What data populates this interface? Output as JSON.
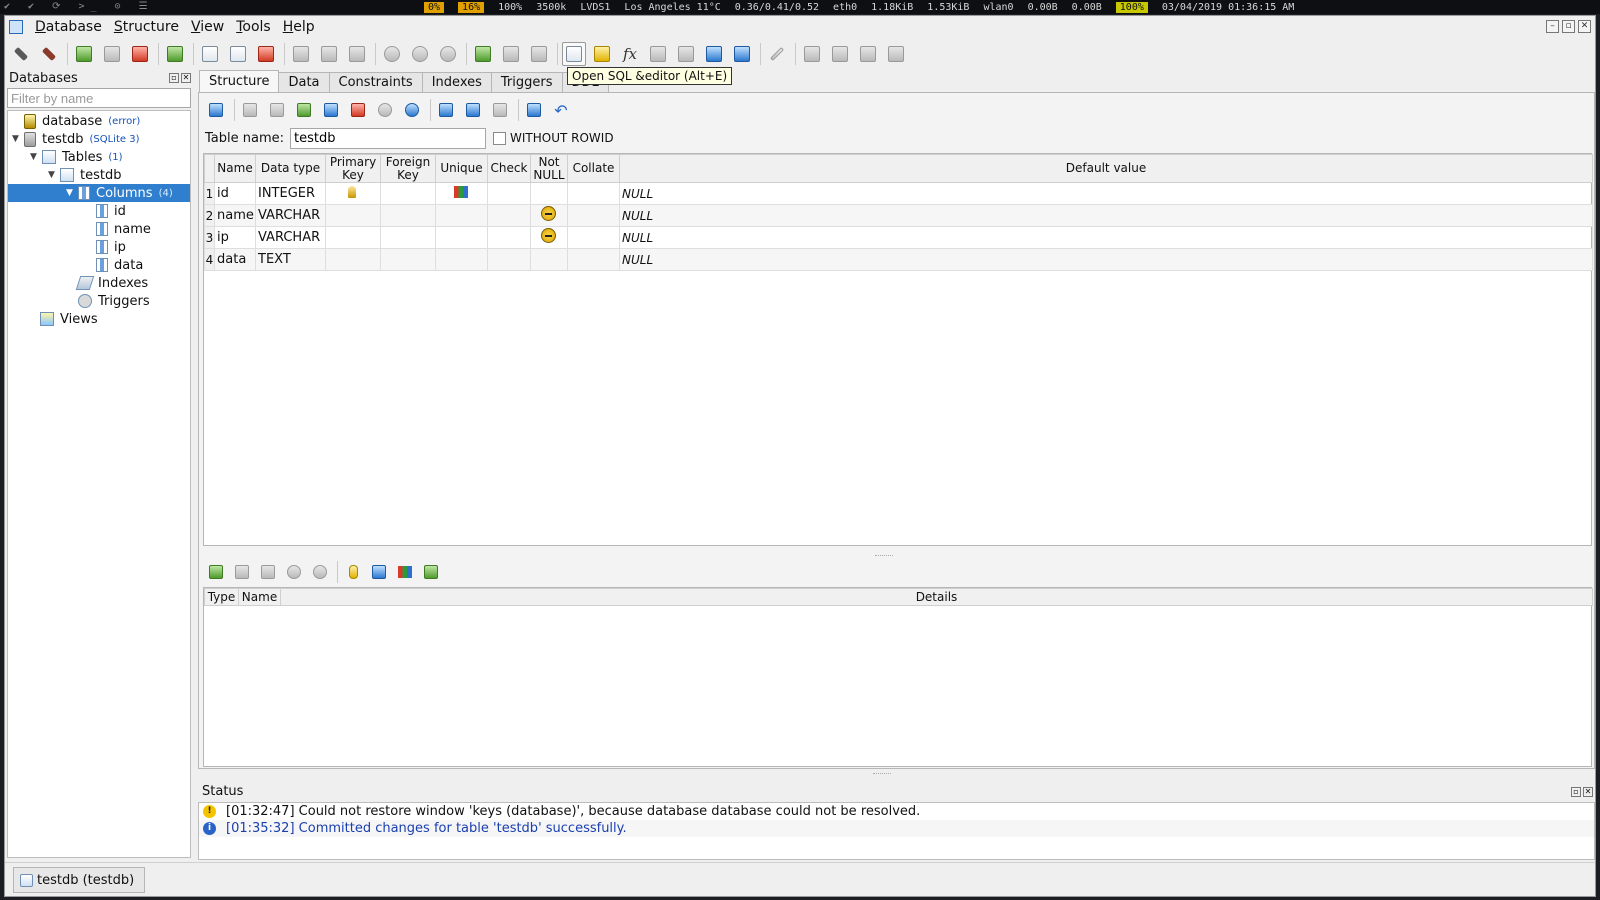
{
  "system_bar": {
    "workspace_icons": "✔ ✔ ⟳ >_ ⊙ ☰",
    "cpu": "0%",
    "cpu2": "16%",
    "volume": "100%",
    "freq": "3500k",
    "display": "LVDS1",
    "weather": "Los Angeles 11°C",
    "load": "0.36/0.41/0.52",
    "eth_label": "eth0",
    "eth_down": "1.18KiB",
    "eth_up": "1.53KiB",
    "wlan_label": "wlan0",
    "wlan_down": "0.00B",
    "wlan_up": "0.00B",
    "battery": "100%",
    "datetime": "03/04/2019 01:36:15 AM"
  },
  "menubar": {
    "items": [
      "Database",
      "Structure",
      "View",
      "Tools",
      "Help"
    ]
  },
  "tooltip": "Open SQL &editor (Alt+E)",
  "left_panel": {
    "title": "Databases",
    "filter_placeholder": "Filter by name",
    "tree": {
      "database": {
        "label": "database",
        "tag": "(error)"
      },
      "testdb": {
        "label": "testdb",
        "tag": "(SQLite 3)"
      },
      "tables": {
        "label": "Tables",
        "tag": "(1)"
      },
      "table_testdb": {
        "label": "testdb"
      },
      "columns": {
        "label": "Columns",
        "tag": "(4)"
      },
      "col_items": [
        "id",
        "name",
        "ip",
        "data"
      ],
      "indexes": "Indexes",
      "triggers": "Triggers",
      "views": "Views"
    }
  },
  "tabs": [
    "Structure",
    "Data",
    "Constraints",
    "Indexes",
    "Triggers",
    "DDL"
  ],
  "structure": {
    "table_name_label": "Table name:",
    "table_name_value": "testdb",
    "without_rowid_label": "WITHOUT ROWID",
    "headers": {
      "name": "Name",
      "data_type": "Data type",
      "primary_key_1": "Primary",
      "primary_key_2": "Key",
      "foreign_key_1": "Foreign",
      "foreign_key_2": "Key",
      "unique": "Unique",
      "check": "Check",
      "not_null_1": "Not",
      "not_null_2": "NULL",
      "collate": "Collate",
      "default_value": "Default value"
    },
    "rows": [
      {
        "num": "1",
        "name": "id",
        "type": "INTEGER",
        "pk": true,
        "unique": true,
        "not_null": false,
        "default": "NULL"
      },
      {
        "num": "2",
        "name": "name",
        "type": "VARCHAR",
        "pk": false,
        "unique": false,
        "not_null": true,
        "default": "NULL"
      },
      {
        "num": "3",
        "name": "ip",
        "type": "VARCHAR",
        "pk": false,
        "unique": false,
        "not_null": true,
        "default": "NULL"
      },
      {
        "num": "4",
        "name": "data",
        "type": "TEXT",
        "pk": false,
        "unique": false,
        "not_null": false,
        "default": "NULL"
      }
    ],
    "constraints_headers": {
      "type": "Type",
      "name": "Name",
      "details": "Details"
    }
  },
  "status": {
    "title": "Status",
    "messages": [
      {
        "level": "warning",
        "icon": "!",
        "text": "[01:32:47]  Could not restore window 'keys (database)', because database database could not be resolved."
      },
      {
        "level": "info",
        "icon": "i",
        "text": "[01:35:32]  Committed changes for table 'testdb' successfully."
      }
    ]
  },
  "taskbar": {
    "window_label": "testdb (testdb)"
  }
}
